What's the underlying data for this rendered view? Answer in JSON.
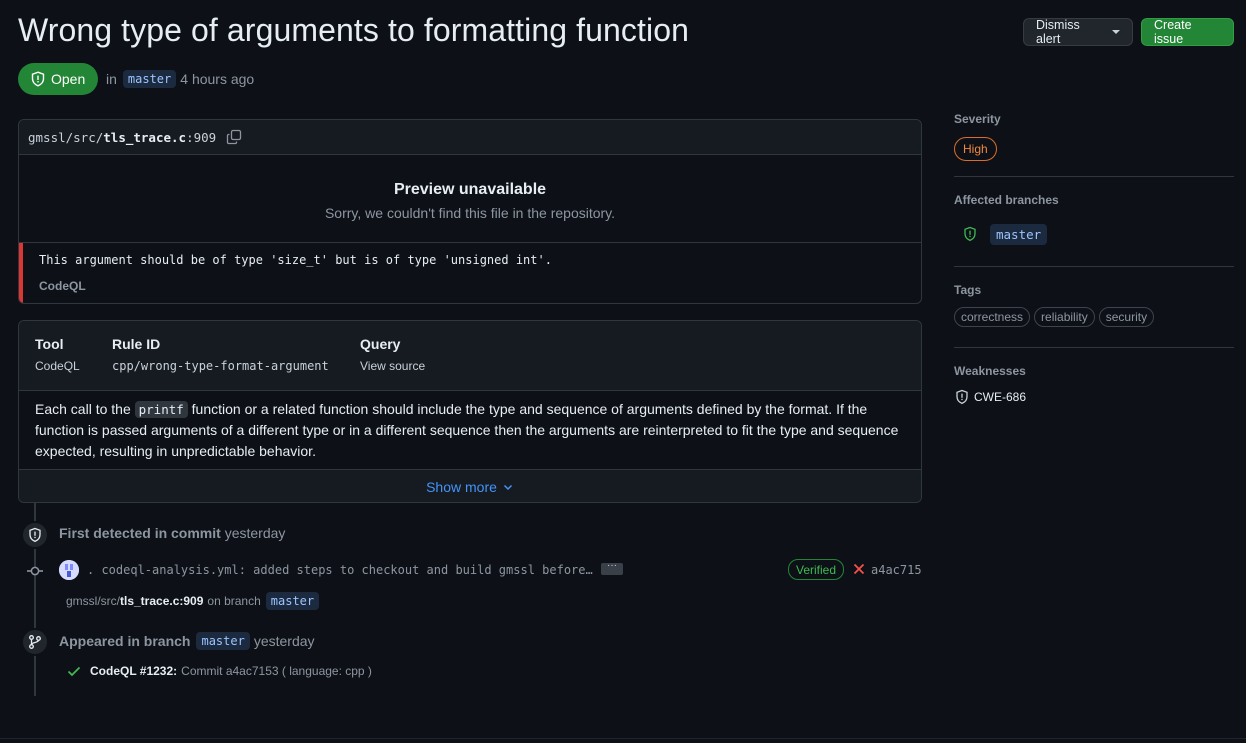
{
  "alert": {
    "title": "Wrong type of arguments to formatting function",
    "state": "Open",
    "in_label": "in",
    "branch": "master",
    "time": "4 hours ago"
  },
  "actions": {
    "dismiss_label": "Dismiss alert",
    "create_label": "Create issue"
  },
  "location": {
    "path_prefix": "gmssl/src/",
    "file": "tls_trace.c",
    "line_suffix": ":909",
    "preview_title": "Preview unavailable",
    "preview_sub": "Sorry, we couldn't find this file in the repository.",
    "message": "This argument should be of type 'size_t' but is of type 'unsigned int'.",
    "message_tool": "CodeQL"
  },
  "rule": {
    "tool_label": "Tool",
    "tool_value": "CodeQL",
    "ruleid_label": "Rule ID",
    "ruleid_value": "cpp/wrong-type-format-argument",
    "query_label": "Query",
    "query_value": "View source",
    "desc_part1": "Each call to the ",
    "desc_code": "printf",
    "desc_part2": " function or a related function should include the type and sequence of arguments defined by the format. If the function is passed arguments of a different type or in a different sequence then the arguments are reinterpreted to fit the type and sequence expected, resulting in unpredictable behavior.",
    "show_more": "Show more"
  },
  "timeline": {
    "first_detected_bold": "First detected in commit",
    "first_detected_time": "yesterday",
    "commit_message": ". codeql-analysis.yml: added steps to checkout and build gmssl before…",
    "commit_ellipsis": "···",
    "verified": "Verified",
    "sha": "a4ac715",
    "path_prefix": "gmssl/src/",
    "path_file": "tls_trace.c:909",
    "on_branch": "on branch",
    "branch": "master",
    "appeared_bold": "Appeared in branch",
    "appeared_branch": "master",
    "appeared_time": "yesterday",
    "run_title": "CodeQL #1232:",
    "run_detail": "Commit a4ac7153 ( language: cpp )"
  },
  "sidebar": {
    "severity_label": "Severity",
    "severity_value": "High",
    "affected_label": "Affected branches",
    "affected_branch": "master",
    "tags_label": "Tags",
    "tags": [
      "correctness",
      "reliability",
      "security"
    ],
    "weaknesses_label": "Weaknesses",
    "weakness": "CWE-686"
  },
  "colors": {
    "background": "#0d1117",
    "open_green": "#238636",
    "severity_orange": "#f0883e",
    "alert_red": "#da3633",
    "link_blue": "#4493f8"
  }
}
